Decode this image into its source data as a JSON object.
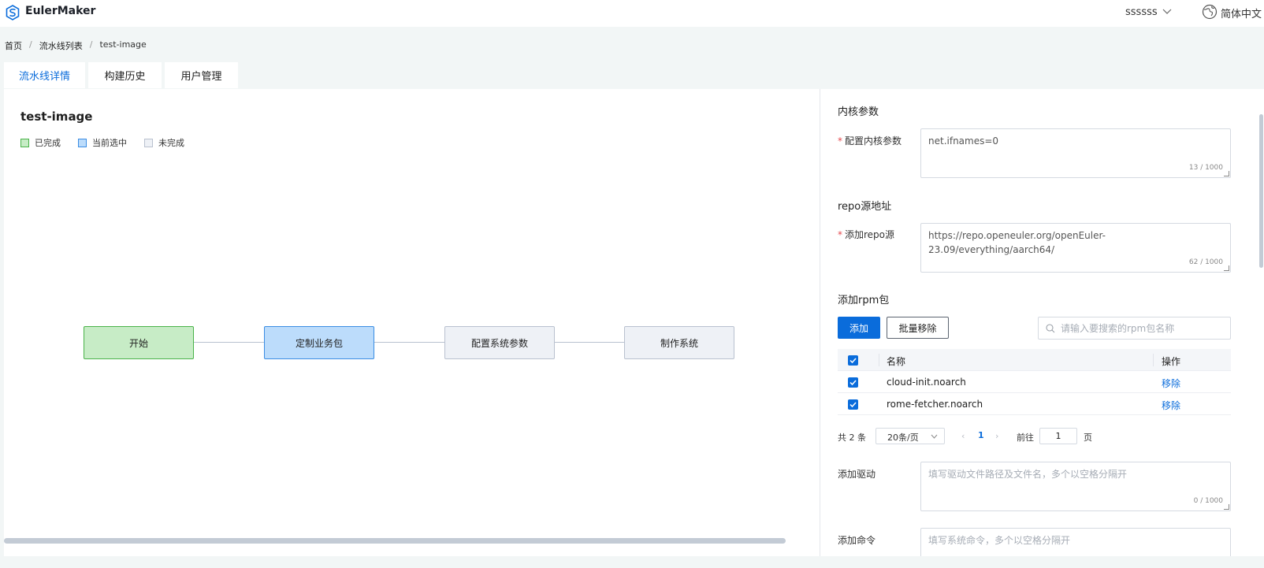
{
  "header": {
    "brand": "EulerMaker",
    "user": "ssssss",
    "language": "简体中文",
    "accent_color": "#0a6cdb"
  },
  "breadcrumb": [
    "首页",
    "流水线列表",
    "test-image"
  ],
  "tabs": [
    {
      "label": "流水线详情",
      "active": true
    },
    {
      "label": "构建历史",
      "active": false
    },
    {
      "label": "用户管理",
      "active": false
    }
  ],
  "pipeline": {
    "title": "test-image",
    "legend": [
      "已完成",
      "当前选中",
      "未完成"
    ],
    "nodes": [
      {
        "label": "开始",
        "status": "done"
      },
      {
        "label": "定制业务包",
        "status": "current"
      },
      {
        "label": "配置系统参数",
        "status": "todo"
      },
      {
        "label": "制作系统",
        "status": "todo"
      }
    ],
    "colors": {
      "done": "#c7ecc6",
      "current": "#bcdcfb",
      "todo": "#eef1f6"
    }
  },
  "form": {
    "kernel": {
      "section": "内核参数",
      "label": "配置内核参数",
      "value": "net.ifnames=0",
      "counter": "13 / 1000"
    },
    "repo": {
      "section": "repo源地址",
      "label": "添加repo源",
      "value_line1": "https://repo.openeuler.org/openEuler-",
      "value_line2": "23.09/everything/aarch64/",
      "counter": "62 / 1000"
    },
    "rpm": {
      "section": "添加rpm包",
      "add_button": "添加",
      "batch_remove_button": "批量移除",
      "search_placeholder": "请输入要搜索的rpm包名称",
      "columns": {
        "name": "名称",
        "op": "操作"
      },
      "rows": [
        {
          "name": "cloud-init.noarch",
          "op": "移除",
          "checked": true
        },
        {
          "name": "rome-fetcher.noarch",
          "op": "移除",
          "checked": true
        }
      ]
    },
    "pager": {
      "total": "共 2 条",
      "page_size": "20条/页",
      "current_page": "1",
      "goto_label": "前往",
      "goto_value": "1",
      "page_unit": "页"
    },
    "driver": {
      "label": "添加驱动",
      "placeholder": "填写驱动文件路径及文件名，多个以空格分隔开",
      "counter": "0 / 1000"
    },
    "command": {
      "label": "添加命令",
      "placeholder": "填写系统命令，多个以空格分隔开"
    }
  }
}
